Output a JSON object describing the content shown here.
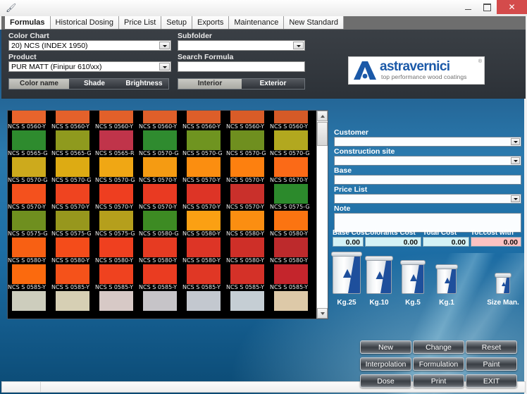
{
  "window": {
    "icon": "app-icon",
    "minimize_label": "–",
    "maximize_label": "❑",
    "close_label": "✕"
  },
  "tabs": [
    {
      "label": "Formulas",
      "active": true
    },
    {
      "label": "Historical Dosing",
      "active": false
    },
    {
      "label": "Price List",
      "active": false
    },
    {
      "label": "Setup",
      "active": false
    },
    {
      "label": "Exports",
      "active": false
    },
    {
      "label": "Maintenance",
      "active": false
    },
    {
      "label": "New Standard",
      "active": false
    }
  ],
  "top_panel": {
    "color_chart": {
      "label": "Color Chart",
      "value": "20) NCS (INDEX 1950)"
    },
    "product": {
      "label": "Product",
      "value": "PUR MATT (Finipur 610\\xx)"
    },
    "subfolder": {
      "label": "Subfolder",
      "value": ""
    },
    "search_formula": {
      "label": "Search Formula",
      "value": "",
      "placeholder": ""
    },
    "sort_segments": [
      {
        "label": "Color name",
        "active": true
      },
      {
        "label": "Shade",
        "active": false
      },
      {
        "label": "Brightness",
        "active": false
      }
    ],
    "use_segments": [
      {
        "label": "Interior",
        "active": true
      },
      {
        "label": "Exterior",
        "active": false
      }
    ]
  },
  "logo": {
    "wordmark": "astravernici",
    "tagline": "top performance wood coatings",
    "registered": "®",
    "brand_color": "#1b59a8"
  },
  "color_grid": {
    "rows": [
      {
        "name_row": "NCS S 0560-Y",
        "colors": [
          "#e8642c",
          "#e4612b",
          "#e2602a",
          "#e05f2a",
          "#dd5e29",
          "#d95c28",
          "#d55a27"
        ],
        "names": [
          "NCS S 0560-Y",
          "NCS S 0560-Y",
          "NCS S 0560-Y",
          "NCS S 0560-Y",
          "NCS S 0560-Y",
          "NCS S 0560-Y",
          "NCS S 0560-Y"
        ]
      },
      {
        "colors": [
          "#2e8b2e",
          "#8f9a1e",
          "#c0344a",
          "#2f8b2f",
          "#6f9420",
          "#6f8f1f",
          "#b2a81f"
        ],
        "names": [
          "NCS S 0565-G",
          "NCS S 0565-G",
          "NCS S 0565-R",
          "NCS S 0570-G",
          "NCS S 0570-G",
          "NCS S 0570-G",
          "NCS S 0570-G"
        ]
      },
      {
        "colors": [
          "#cdaa1c",
          "#ddab13",
          "#f0a714",
          "#f59b12",
          "#fb8e10",
          "#fd800f",
          "#fb6a17"
        ],
        "names": [
          "NCS S 0570-G",
          "NCS S 0570-G",
          "NCS S 0570-G",
          "NCS S 0570-Y",
          "NCS S 0570-Y",
          "NCS S 0570-Y",
          "NCS S 0570-Y"
        ]
      },
      {
        "colors": [
          "#f4511d",
          "#ef4420",
          "#ee3e20",
          "#e93a22",
          "#dd3426",
          "#c9302b",
          "#2c8a2c"
        ],
        "names": [
          "NCS S 0570-Y",
          "NCS S 0570-Y",
          "NCS S 0570-Y",
          "NCS S 0570-Y",
          "NCS S 0570-Y",
          "NCS S 0570-Y",
          "NCS S 0575-G"
        ]
      },
      {
        "colors": [
          "#6f8f1f",
          "#97971d",
          "#b59f1c",
          "#3d8b23",
          "#fba013",
          "#fb8e11",
          "#fb7411"
        ],
        "names": [
          "NCS S 0575-G",
          "NCS S 0575-G",
          "NCS S 0575-G",
          "NCS S 0580-G",
          "NCS S 0580-Y",
          "NCS S 0580-Y",
          "NCS S 0580-Y"
        ]
      },
      {
        "colors": [
          "#f86013",
          "#f44c1a",
          "#ef401f",
          "#e63b22",
          "#dd3526",
          "#ce2f28",
          "#bd2a2c"
        ],
        "names": [
          "NCS S 0580-Y",
          "NCS S 0580-Y",
          "NCS S 0580-Y",
          "NCS S 0580-Y",
          "NCS S 0580-Y",
          "NCS S 0580-Y",
          "NCS S 0580-Y"
        ]
      },
      {
        "colors": [
          "#fb6a0e",
          "#f5521a",
          "#ef421f",
          "#ea3c21",
          "#e03725",
          "#d43128",
          "#c4252c"
        ],
        "names": [
          "NCS S 0585-Y",
          "NCS S 0585-Y",
          "NCS S 0585-Y",
          "NCS S 0585-Y",
          "NCS S 0585-Y",
          "NCS S 0585-Y",
          "NCS S 0585-Y"
        ]
      },
      {
        "colors": [
          "#cdcdbd",
          "#d6cfb4",
          "#d7c9c6",
          "#c6c4c8",
          "#c3c8cf",
          "#c5ced4",
          "#ddc9a8"
        ],
        "names": [
          "",
          "",
          "",
          "",
          "",
          "",
          ""
        ]
      }
    ],
    "scrollbar": {
      "up": "▲",
      "down": "▼"
    }
  },
  "right_panel": {
    "customer": {
      "label": "Customer",
      "value": ""
    },
    "construction_site": {
      "label": "Construction site",
      "value": ""
    },
    "base": {
      "label": "Base",
      "value": ""
    },
    "price_list": {
      "label": "Price List",
      "value": ""
    },
    "note": {
      "label": "Note",
      "value": ""
    },
    "costs": [
      {
        "label": "Base Cost",
        "value": "0.00",
        "kind": "normal"
      },
      {
        "label": "Colorants Cost",
        "value": "0.00",
        "kind": "normal"
      },
      {
        "label": "Total Cost",
        "value": "0.00",
        "kind": "normal"
      },
      {
        "label": "Tot.cost with Vat",
        "value": "0.00",
        "kind": "vat"
      }
    ]
  },
  "cans": [
    {
      "label": "Kg.25"
    },
    {
      "label": "Kg.10"
    },
    {
      "label": "Kg.5"
    },
    {
      "label": "Kg.1"
    },
    {
      "label": "Size Man."
    }
  ],
  "actions": [
    {
      "label": "New"
    },
    {
      "label": "Change"
    },
    {
      "label": "Reset"
    },
    {
      "label": "Interpolation"
    },
    {
      "label": "Formulation"
    },
    {
      "label": "Paint"
    },
    {
      "label": "Dose"
    },
    {
      "label": "Print"
    },
    {
      "label": "EXIT"
    }
  ],
  "statusbar": {
    "left": "",
    "right": ""
  }
}
